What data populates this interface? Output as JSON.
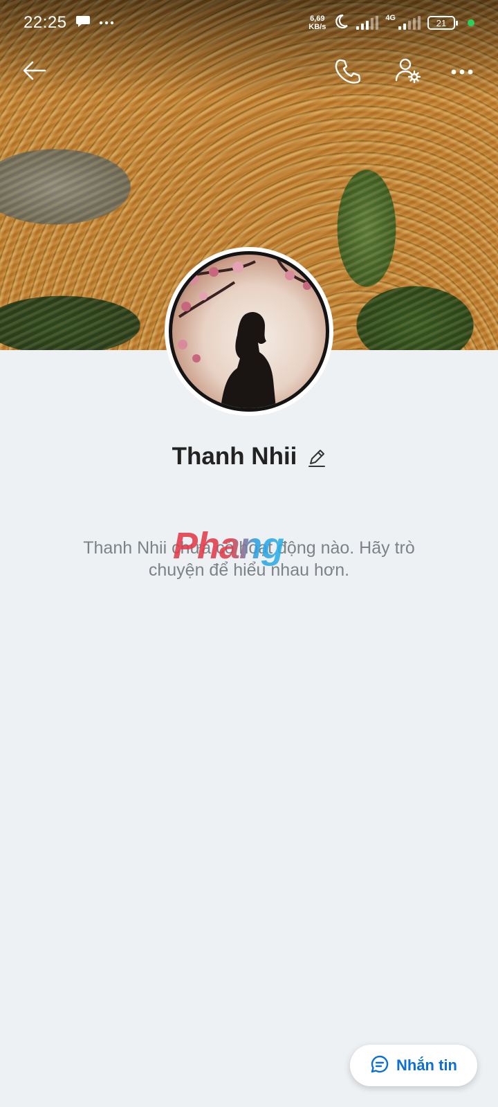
{
  "status_bar": {
    "time": "22:25",
    "net_speed_value": "6,69",
    "net_speed_unit": "KB/s",
    "network_type": "4G",
    "battery_level": "21",
    "indicator_color": "#2bd05a",
    "icons": [
      "chat-bubble-icon",
      "more-dots-icon",
      "moon-icon",
      "signal-icon",
      "battery-icon"
    ]
  },
  "top_nav": {
    "icons": [
      "back-arrow-icon",
      "phone-icon",
      "user-settings-icon",
      "more-icon"
    ]
  },
  "profile": {
    "name": "Thanh Nhii",
    "empty_activity_text": "Thanh Nhii chưa có hoạt động nào. Hãy trò chuyện để hiểu nhau hơn."
  },
  "watermark": {
    "text": "Phang"
  },
  "action": {
    "message_label": "Nhắn tin",
    "accent_color": "#0d6fd6"
  }
}
